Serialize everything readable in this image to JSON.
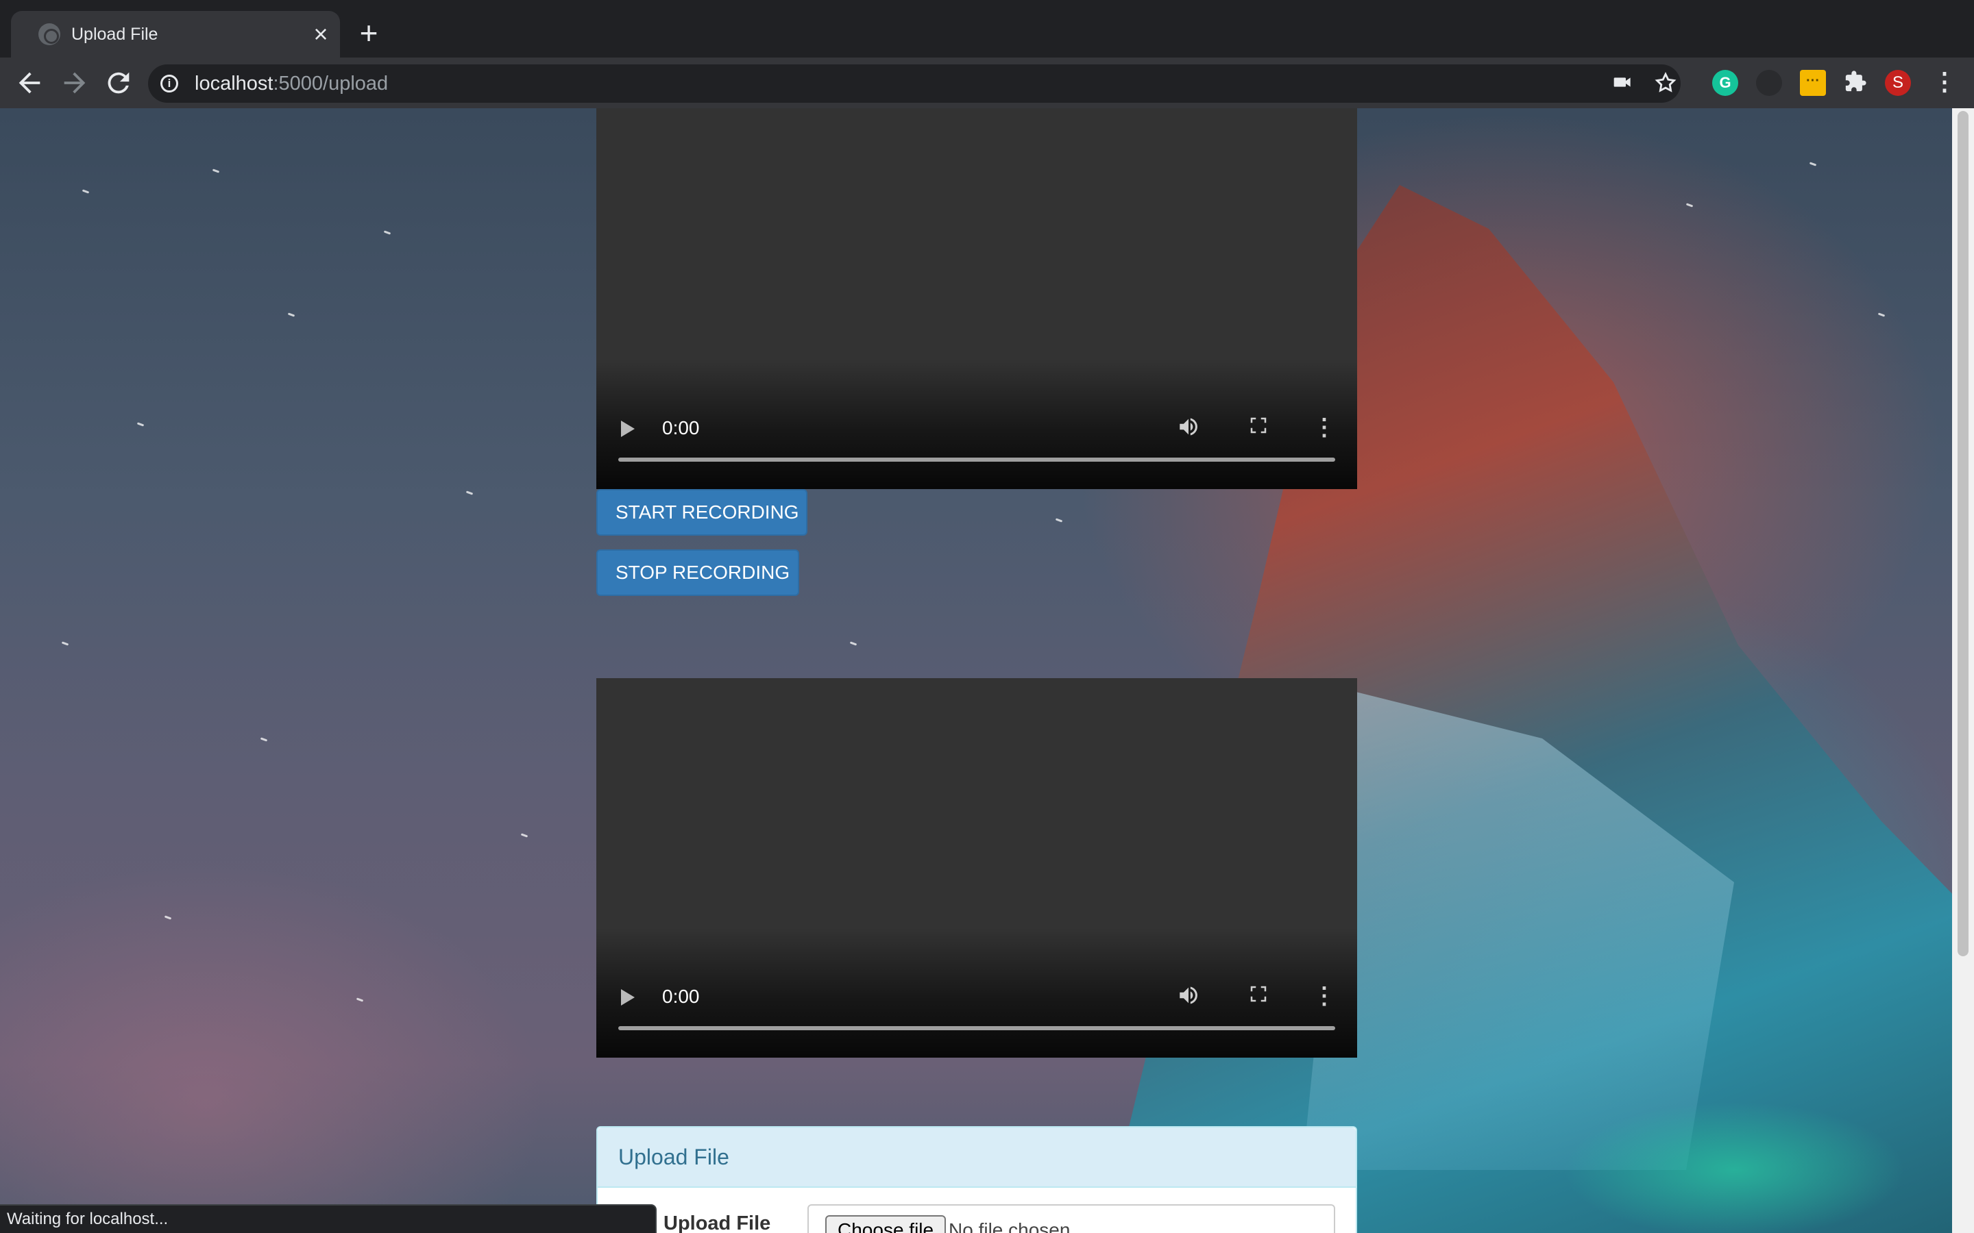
{
  "browser": {
    "tab": {
      "title": "Upload File",
      "close_label": "×"
    },
    "new_tab_label": "+",
    "address": {
      "host": "localhost",
      "path": ":5000/upload"
    },
    "status_text": "Waiting for localhost...",
    "profile_initial": "S",
    "extension_grammarly_label": "G"
  },
  "videos": [
    {
      "time": "0:00"
    },
    {
      "time": "0:00"
    }
  ],
  "buttons": {
    "start_recording": "START RECORDING",
    "stop_recording": "STOP RECORDING"
  },
  "upload_panel": {
    "heading": "Upload File",
    "field_label": "Upload File",
    "choose_button": "Choose file",
    "no_file_text": "No file chosen"
  },
  "colors": {
    "primary_button": "#337ab7",
    "panel_heading_bg": "#d9edf7",
    "panel_heading_text": "#31708f"
  },
  "icons": {
    "back": "arrow-left-icon",
    "forward": "arrow-right-icon",
    "reload": "reload-icon",
    "site_info": "info-icon",
    "camera": "camera-icon",
    "bookmark": "star-icon",
    "extensions": "puzzle-icon",
    "menu": "kebab-menu-icon"
  }
}
